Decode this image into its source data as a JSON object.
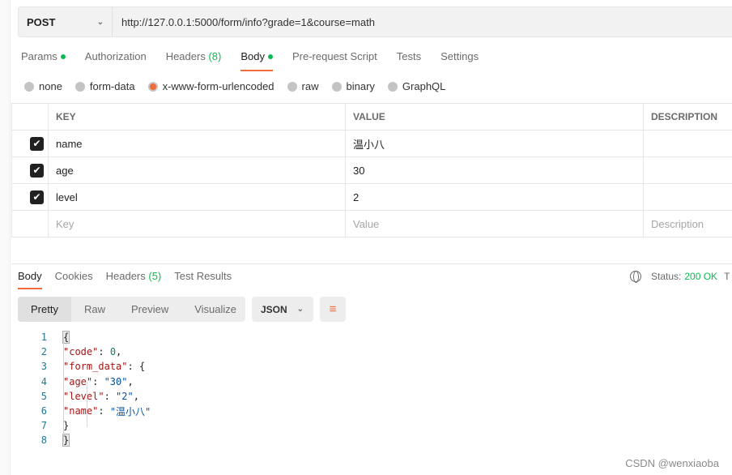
{
  "request": {
    "method": "POST",
    "url": "http://127.0.0.1:5000/form/info?grade=1&course=math"
  },
  "tabs": [
    {
      "label": "Params",
      "dot": true
    },
    {
      "label": "Authorization"
    },
    {
      "label": "Headers",
      "count": "(8)"
    },
    {
      "label": "Body",
      "dot": true,
      "active": true
    },
    {
      "label": "Pre-request Script"
    },
    {
      "label": "Tests"
    },
    {
      "label": "Settings"
    }
  ],
  "body_types": [
    {
      "label": "none"
    },
    {
      "label": "form-data"
    },
    {
      "label": "x-www-form-urlencoded",
      "selected": true
    },
    {
      "label": "raw"
    },
    {
      "label": "binary"
    },
    {
      "label": "GraphQL"
    }
  ],
  "table": {
    "headers": [
      "KEY",
      "VALUE",
      "DESCRIPTION"
    ],
    "rows": [
      {
        "key": "name",
        "value": "温小八",
        "checked": true
      },
      {
        "key": "age",
        "value": "30",
        "checked": true
      },
      {
        "key": "level",
        "value": "2",
        "checked": true
      }
    ],
    "placeholders": {
      "key": "Key",
      "value": "Value",
      "description": "Description"
    }
  },
  "response": {
    "tabs": [
      {
        "label": "Body",
        "active": true
      },
      {
        "label": "Cookies"
      },
      {
        "label": "Headers",
        "count": "(5)"
      },
      {
        "label": "Test Results"
      }
    ],
    "status_label": "Status:",
    "status_value": "200 OK",
    "truncated": "T",
    "views": [
      "Pretty",
      "Raw",
      "Preview",
      "Visualize"
    ],
    "format": "JSON",
    "code": {
      "line_numbers": [
        "1",
        "2",
        "3",
        "4",
        "5",
        "6",
        "7",
        "8"
      ],
      "open": "{",
      "code_key": "\"code\"",
      "code_val": "0",
      "form_key": "\"form_data\"",
      "age_key": "\"age\"",
      "age_val": "\"30\"",
      "level_key": "\"level\"",
      "level_val": "\"2\"",
      "name_key": "\"name\"",
      "name_val": "\"温小八\"",
      "close": "}"
    }
  },
  "watermark": "CSDN @wenxiaoba",
  "colors": {
    "accent": "#f26b3a",
    "success": "#0cbb52"
  }
}
